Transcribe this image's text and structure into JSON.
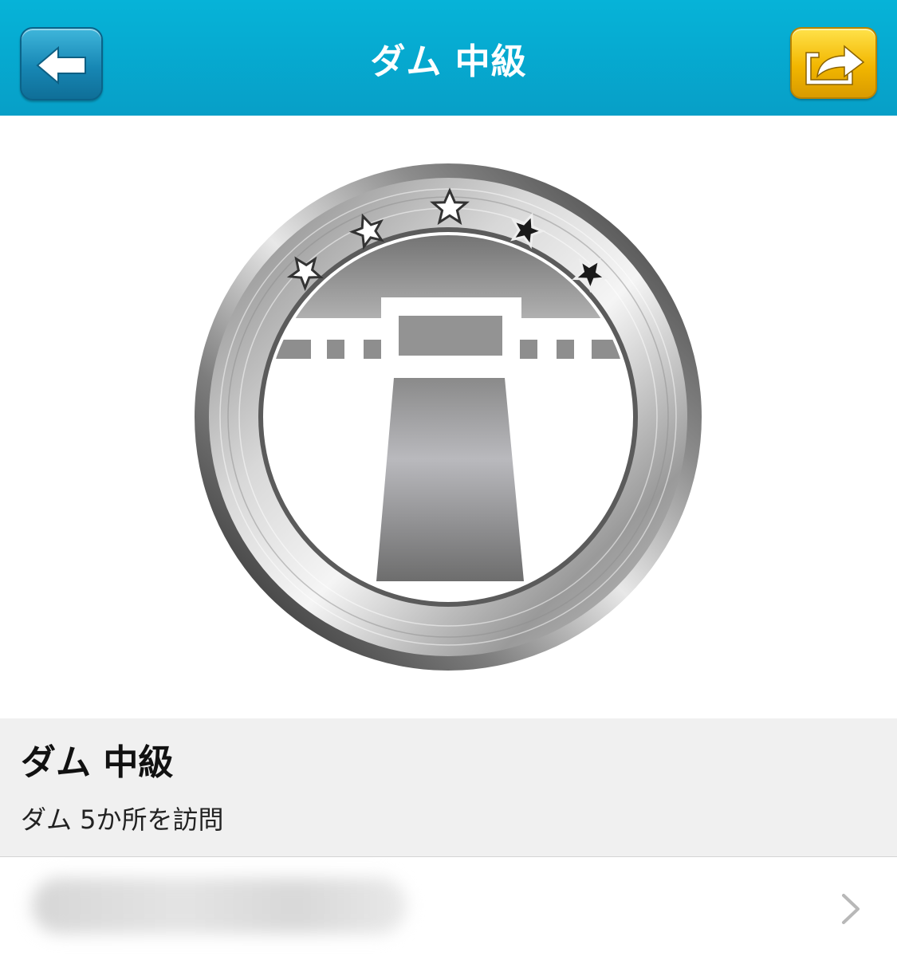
{
  "nav": {
    "title": "ダム 中級",
    "back_icon": "back-arrow-icon",
    "share_icon": "share-arrow-icon"
  },
  "badge": {
    "icon": "dam-medal-icon",
    "stars_total": 5,
    "stars_filled": 3,
    "colors": {
      "ring": "#8a8a8a",
      "star_earned": "#ffffff",
      "star_unearned": "#1a1a1a"
    }
  },
  "info": {
    "title": "ダム 中級",
    "description": "ダム 5か所を訪問"
  },
  "link_row": {
    "text": "",
    "chevron_icon": "chevron-right-icon"
  },
  "colors": {
    "nav_bar": "#07a9d1",
    "share_button": "#f2b600",
    "back_button": "#1787b4",
    "info_panel": "#f0f0f0"
  }
}
